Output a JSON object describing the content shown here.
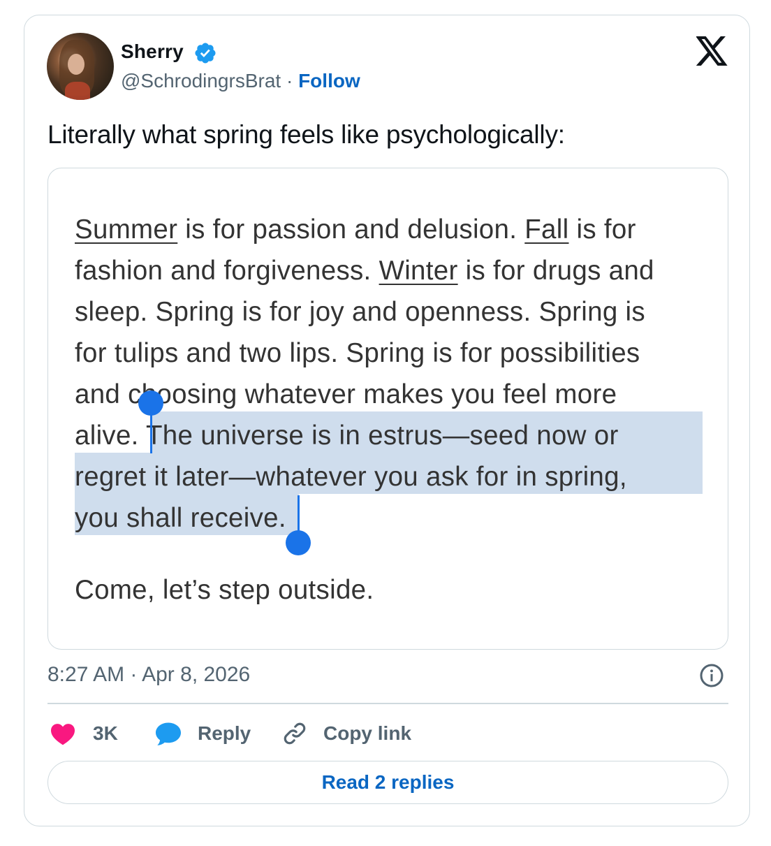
{
  "author": {
    "name": "Sherry",
    "handle": "@SchrodingrsBrat",
    "separator": "·",
    "follow_label": "Follow"
  },
  "tweet": {
    "text": "Literally what spring feels like psychologically:"
  },
  "excerpt": {
    "lines": [
      [
        "Summer",
        " is for passion and delusion. ",
        "Fall",
        " is for"
      ],
      [
        "fashion and forgiveness. ",
        "Winter",
        " is for drugs and"
      ],
      [
        "sleep. Spring is for joy and openness. Spring is"
      ],
      [
        "for tulips and two lips. Spring is for possibilities"
      ],
      [
        "and choosing whatever makes you feel more"
      ],
      [
        "alive. ",
        "The universe is in estrus—seed now or"
      ],
      [
        "regret it later—whatever you ask for in spring,"
      ],
      [
        "you shall receive."
      ]
    ],
    "closing": "Come, let’s step outside."
  },
  "meta": {
    "time": "8:27 AM",
    "separator": "·",
    "date": "Apr 8, 2026"
  },
  "actions": {
    "likes": "3K",
    "reply_label": "Reply",
    "copy_label": "Copy link",
    "read_replies_label": "Read 2 replies"
  },
  "colors": {
    "like": "#f91880",
    "reply": "#1d9bf0",
    "link_blue": "#0a66c2",
    "selection": "#cfdded",
    "selection_handle": "#1a73e8"
  },
  "icons": [
    "verified-badge-icon",
    "x-logo-icon",
    "info-icon",
    "heart-icon",
    "reply-bubble-icon",
    "link-icon"
  ]
}
